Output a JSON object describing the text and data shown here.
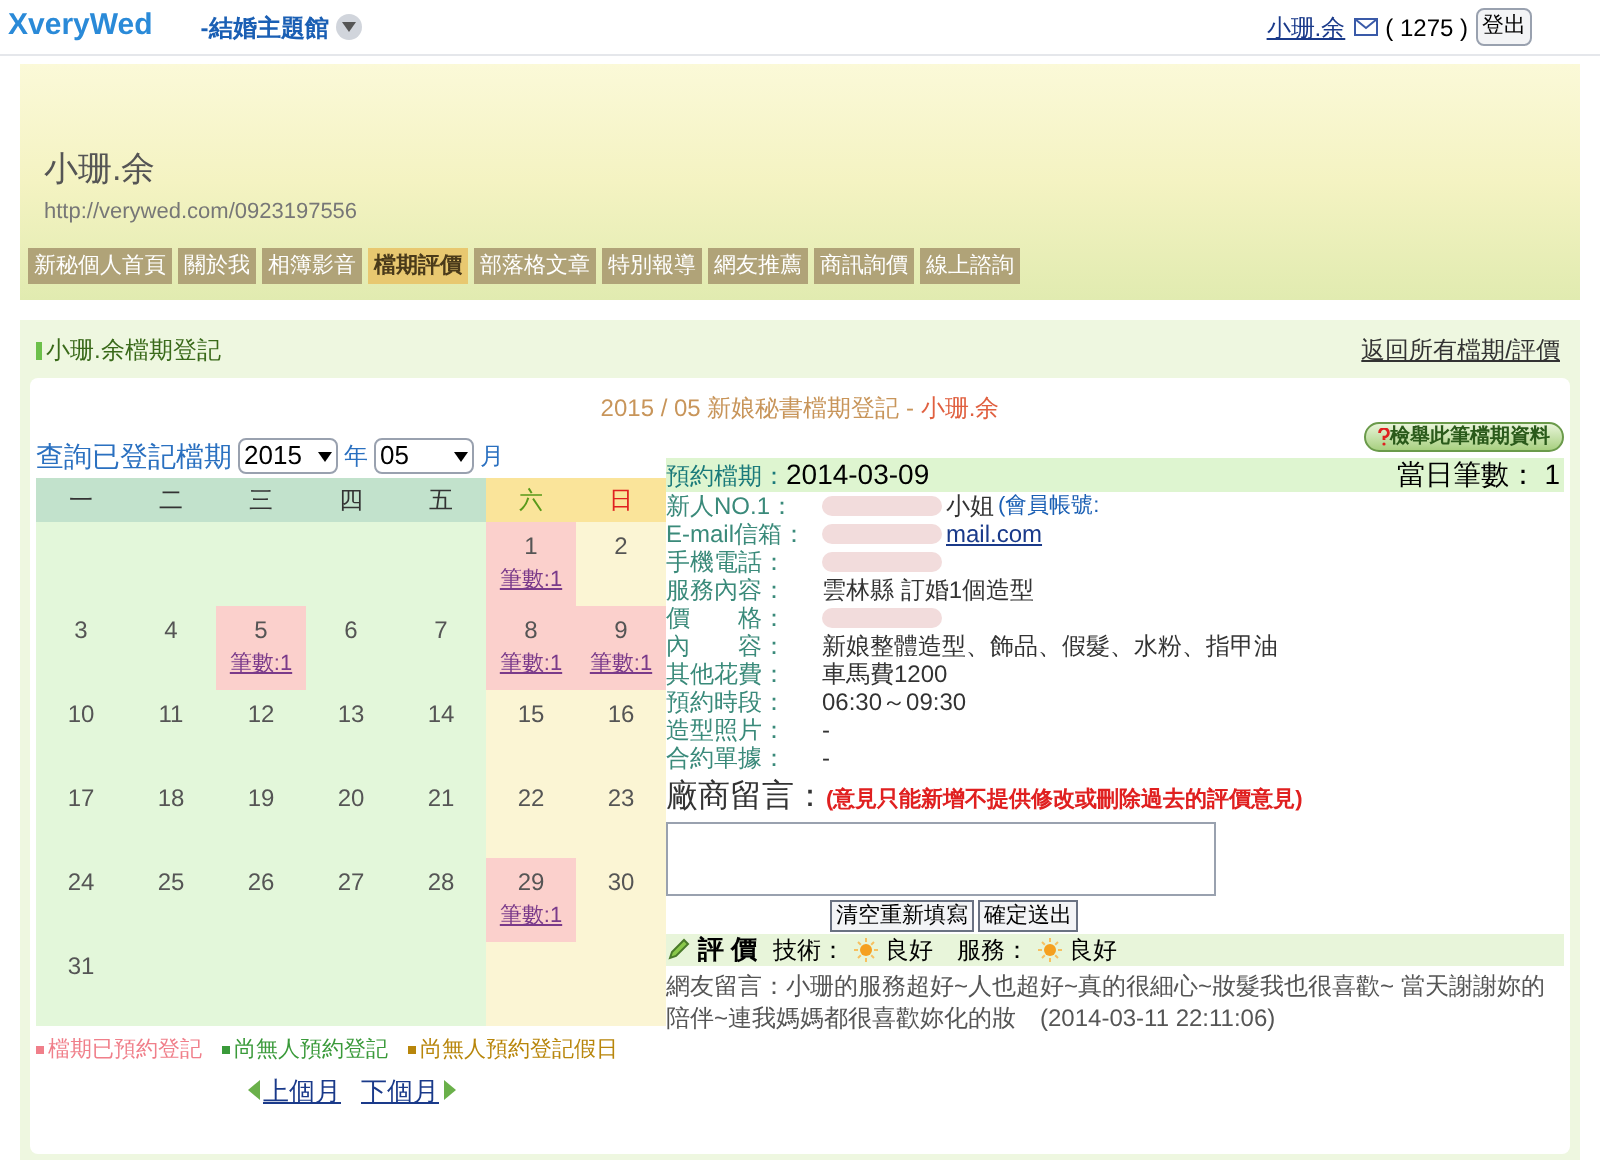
{
  "top_bar": {
    "logo": "XveryWed",
    "theme_menu": "-結婚主題館",
    "user": "小珊.余",
    "message_count": "( 1275 )",
    "logout": "登出"
  },
  "banner": {
    "name": "小珊.余",
    "url": "http://verywed.com/0923197556"
  },
  "nav": [
    {
      "label": "新秘個人首頁",
      "selected": false
    },
    {
      "label": "關於我",
      "selected": false
    },
    {
      "label": "相簿影音",
      "selected": false
    },
    {
      "label": "檔期評價",
      "selected": true
    },
    {
      "label": "部落格文章",
      "selected": false
    },
    {
      "label": "特別報導",
      "selected": false
    },
    {
      "label": "網友推薦",
      "selected": false
    },
    {
      "label": "商訊詢價",
      "selected": false
    },
    {
      "label": "線上諮詢",
      "selected": false
    }
  ],
  "section": {
    "title": "小珊.余檔期登記",
    "back_link": "返回所有檔期/評價"
  },
  "page_heading": {
    "text": "2015 / 05 新娘秘書檔期登記 - ",
    "name": "小珊.余"
  },
  "query": {
    "label": "查詢已登記檔期",
    "year": "2015",
    "year_unit": "年",
    "month": "05",
    "month_unit": "月"
  },
  "calendar": {
    "weekdays": [
      "一",
      "二",
      "三",
      "四",
      "五",
      "六",
      "日"
    ],
    "weeks": [
      [
        {
          "kind": "blank"
        },
        {
          "kind": "blank"
        },
        {
          "kind": "blank"
        },
        {
          "kind": "blank"
        },
        {
          "kind": "blank"
        },
        {
          "day": "1",
          "booked": true,
          "count": "筆數:1"
        },
        {
          "day": "2",
          "booked": false
        }
      ],
      [
        {
          "day": "3",
          "booked": false
        },
        {
          "day": "4",
          "booked": false
        },
        {
          "day": "5",
          "booked": true,
          "count": "筆數:1"
        },
        {
          "day": "6",
          "booked": false
        },
        {
          "day": "7",
          "booked": false
        },
        {
          "day": "8",
          "booked": true,
          "count": "筆數:1"
        },
        {
          "day": "9",
          "booked": true,
          "count": "筆數:1"
        }
      ],
      [
        {
          "day": "10",
          "booked": false
        },
        {
          "day": "11",
          "booked": false
        },
        {
          "day": "12",
          "booked": false
        },
        {
          "day": "13",
          "booked": false
        },
        {
          "day": "14",
          "booked": false
        },
        {
          "day": "15",
          "booked": false
        },
        {
          "day": "16",
          "booked": false
        }
      ],
      [
        {
          "day": "17",
          "booked": false
        },
        {
          "day": "18",
          "booked": false
        },
        {
          "day": "19",
          "booked": false
        },
        {
          "day": "20",
          "booked": false
        },
        {
          "day": "21",
          "booked": false
        },
        {
          "day": "22",
          "booked": false
        },
        {
          "day": "23",
          "booked": false
        }
      ],
      [
        {
          "day": "24",
          "booked": false
        },
        {
          "day": "25",
          "booked": false
        },
        {
          "day": "26",
          "booked": false
        },
        {
          "day": "27",
          "booked": false
        },
        {
          "day": "28",
          "booked": false
        },
        {
          "day": "29",
          "booked": true,
          "count": "筆數:1"
        },
        {
          "day": "30",
          "booked": false
        }
      ],
      [
        {
          "day": "31",
          "booked": false
        },
        {
          "kind": "blank"
        },
        {
          "kind": "blank"
        },
        {
          "kind": "blank"
        },
        {
          "kind": "blank"
        },
        {
          "kind": "blank"
        },
        {
          "kind": "blank"
        }
      ]
    ],
    "legend": [
      {
        "label": "檔期已預約登記",
        "color": "#f07f8a"
      },
      {
        "label": "尚無人預約登記",
        "color": "#3a9a3a"
      },
      {
        "label": "尚無人預約登記假日",
        "color": "#b8860b"
      }
    ],
    "prev": "上個月",
    "next": "下個月"
  },
  "detail": {
    "report_button": "檢舉此筆檔期資料",
    "date_label": "預約檔期：",
    "date": "2014-03-09",
    "day_count": "當日筆數： 1",
    "fields": [
      {
        "label": "新人NO.1：",
        "value": "小姐",
        "extra": "(會員帳號:",
        "redacted": true
      },
      {
        "label": "E-mail信箱：",
        "link": "mail.com",
        "redacted": true
      },
      {
        "label": "手機電話：",
        "redacted": true
      },
      {
        "label": "服務內容：",
        "value": "雲林縣 訂婚1個造型",
        "redacted": false
      },
      {
        "label": "價　　格：",
        "redacted": true
      },
      {
        "label": "內　　容：",
        "value": "新娘整體造型、飾品、假髮、水粉、指甲油",
        "redacted": false
      },
      {
        "label": "其他花費：",
        "value": "車馬費1200",
        "redacted": false
      },
      {
        "label": "預約時段：",
        "value": "06:30～09:30",
        "redacted": false
      },
      {
        "label": "造型照片：",
        "value": "-",
        "redacted": false
      },
      {
        "label": "合約單據：",
        "value": "-",
        "redacted": false
      }
    ],
    "comment_label": "廠商留言：",
    "comment_note": "(意見只能新增不提供修改或刪除過去的評價意見)",
    "buttons": [
      "清空重新填寫",
      "確定送出"
    ],
    "rating": {
      "title": "評 價",
      "skill_label": "技術：",
      "skill": "良好",
      "service_label": "服務：",
      "service": "良好"
    },
    "review": "網友留言：小珊的服務超好~人也超好~真的很細心~妝髮我也很喜歡~ 當天謝謝妳的陪伴~連我媽媽都很喜歡妳化的妝　(2014-03-11 22:11:06)"
  }
}
